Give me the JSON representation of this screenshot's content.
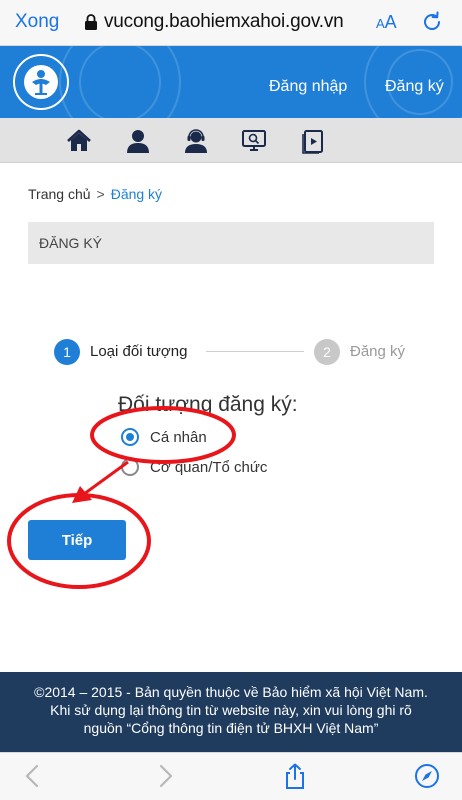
{
  "browser": {
    "done_label": "Xong",
    "host": "vucong.baohiemxahoi.gov.vn",
    "text_size_label": "AA",
    "icons": [
      "lock-icon",
      "reload-icon",
      "back-icon",
      "forward-icon",
      "share-icon",
      "compass-icon"
    ]
  },
  "header": {
    "login_label": "Đăng nhập",
    "register_label": "Đăng ký",
    "logo_name": "bhxh-logo",
    "brand_color": "#1f7fd6"
  },
  "icon_nav": {
    "items": [
      "home-icon",
      "user-icon",
      "support-agent-icon",
      "monitor-search-icon",
      "video-book-icon"
    ]
  },
  "breadcrumb": {
    "home": "Trang chủ",
    "separator": ">",
    "current": "Đăng ký"
  },
  "page": {
    "title": "ĐĂNG KÝ"
  },
  "stepper": {
    "steps": [
      {
        "number": "1",
        "label": "Loại đối tượng",
        "active": true
      },
      {
        "number": "2",
        "label": "Đăng ký",
        "active": false
      }
    ]
  },
  "form": {
    "heading": "Đối tượng đăng ký:",
    "options": [
      {
        "label": "Cá nhân",
        "selected": true
      },
      {
        "label": "Cơ quan/Tổ chức",
        "selected": false
      }
    ],
    "next_label": "Tiếp"
  },
  "footer": {
    "line1": "©2014 – 2015 - Bản quyền thuộc về Bảo hiểm xã hội Việt Nam.",
    "line2": "Khi sử dụng lại thông tin từ website này, xin vui lòng ghi rõ",
    "line3": "nguồn “Cổng thông tin điện tử BHXH Việt Nam”",
    "background": "#1f3b5e"
  },
  "annotations": {
    "color": "#e8151b"
  }
}
